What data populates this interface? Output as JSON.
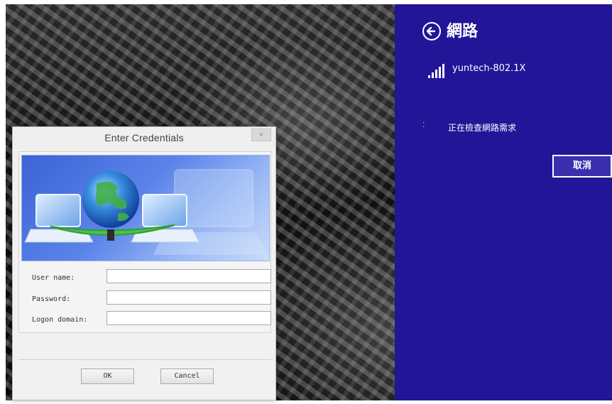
{
  "dialog": {
    "title": "Enter Credentials",
    "close_glyph": "×",
    "fields": [
      {
        "label": "User name:",
        "value": ""
      },
      {
        "label": "Password:",
        "value": ""
      },
      {
        "label": "Logon domain:",
        "value": ""
      }
    ],
    "ok_label": "OK",
    "cancel_label": "Cancel",
    "banner_icon": "network-globe-laptops-icon"
  },
  "charm": {
    "title": "網路",
    "back_icon": "back-arrow-icon",
    "network": {
      "ssid": "yuntech-802.1X",
      "icon": "wifi-signal-icon"
    },
    "status_text": "正在檢查網路需求",
    "cancel_label": "取消",
    "background_color": "#221598"
  }
}
